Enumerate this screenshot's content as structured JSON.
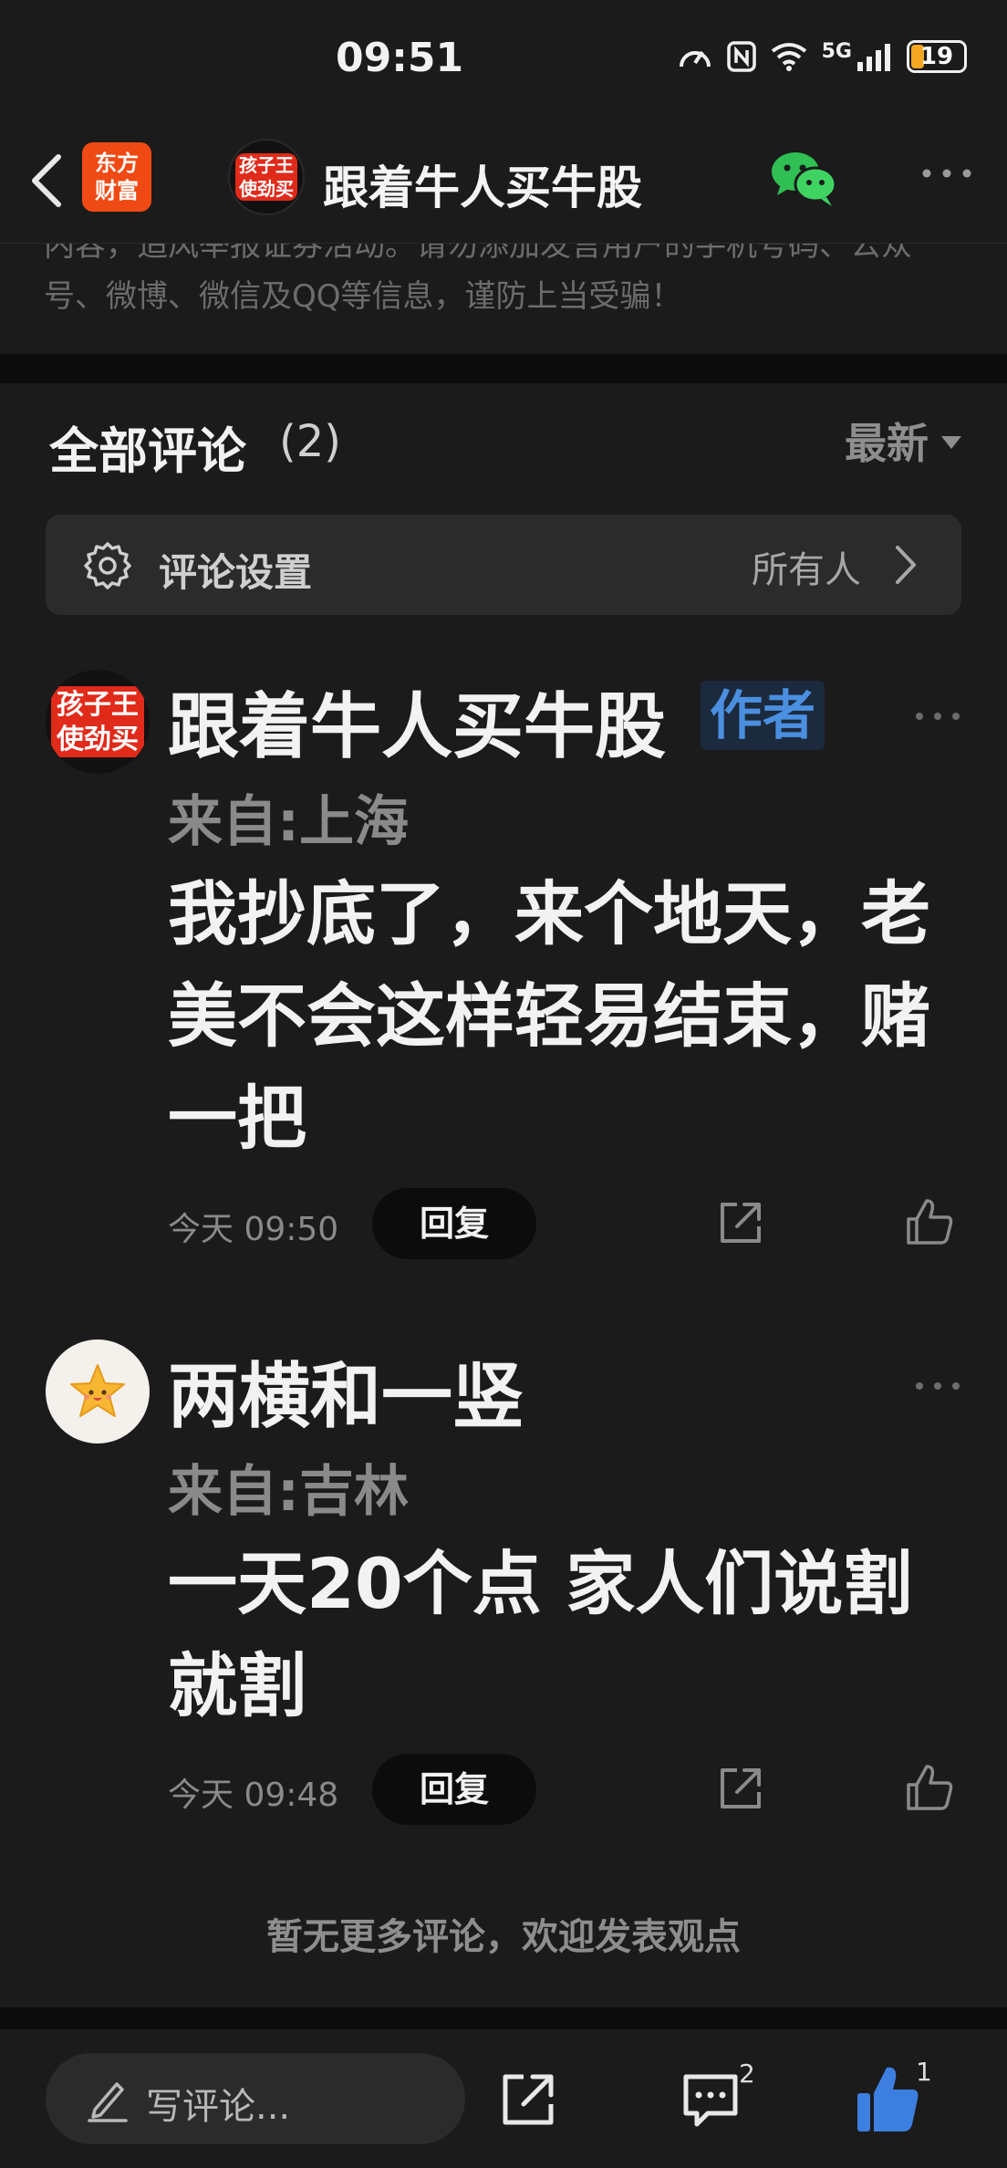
{
  "status_bar": {
    "time": "09:51",
    "network": "5G",
    "battery": "19",
    "icons": [
      "speed-icon",
      "nfc-icon",
      "wifi-icon",
      "signal-icon",
      "battery-icon"
    ]
  },
  "nav": {
    "app_logo_line1": "东方",
    "app_logo_line2": "财富",
    "avatar_line1": "孩子王",
    "avatar_line2": "使劲买",
    "title": "跟着牛人买牛股",
    "icons": [
      "back-icon",
      "wechat-icon",
      "more-icon"
    ]
  },
  "notice": {
    "line1": "内容，追风举报证券活动。请勿添加发言用户的手机号码、公众",
    "line2": "号、微博、微信及QQ等信息，谨防上当受骗！"
  },
  "comments_header": {
    "title": "全部评论",
    "count": "(2)",
    "sort_label": "最新"
  },
  "settings": {
    "label": "评论设置",
    "value": "所有人"
  },
  "comments": [
    {
      "avatar_line1": "孩子王",
      "avatar_line2": "使劲买",
      "name": "跟着牛人买牛股",
      "tag": "作者",
      "location": "来自:上海",
      "text": "我抄底了，来个地天，老美不会这样轻易结束，赌一把",
      "time": "今天 09:50",
      "reply_label": "回复"
    },
    {
      "name": "两横和一竖",
      "location": "来自:吉林",
      "text": "一天20个点 家人们说割就割",
      "time": "今天 09:48",
      "reply_label": "回复"
    }
  ],
  "no_more": "暂无更多评论，欢迎发表观点",
  "bottom_bar": {
    "write_placeholder": "写评论...",
    "comment_count": "2",
    "like_count": "1"
  },
  "colors": {
    "background": "#1b1b1c",
    "accent_blue": "#3d7fe0",
    "logo_orange": "#f04a14",
    "avatar_red": "#e02a1a"
  }
}
